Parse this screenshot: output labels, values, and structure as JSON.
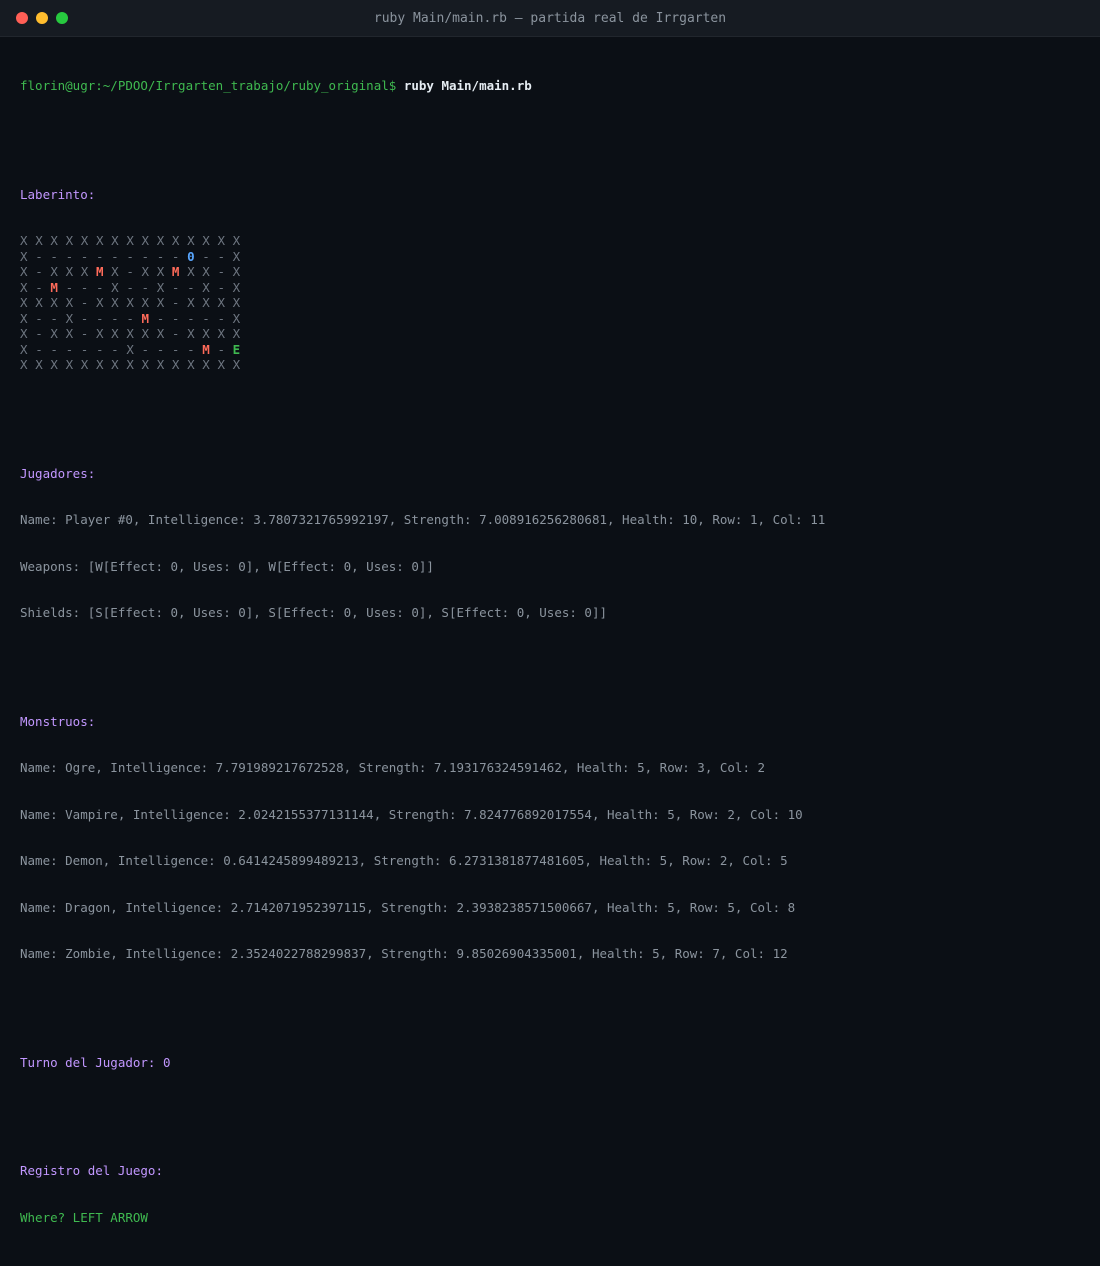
{
  "window": {
    "title": "ruby Main/main.rb — partida real de Irrgarten"
  },
  "prompt": {
    "user_path": "florin@ugr:~/PDOO/Irrgarten_trabajo/ruby_original$",
    "command": "ruby Main/main.rb"
  },
  "labyrinth": {
    "heading": "Laberinto:",
    "rows": [
      [
        "X",
        "X",
        "X",
        "X",
        "X",
        "X",
        "X",
        "X",
        "X",
        "X",
        "X",
        "X",
        "X",
        "X",
        "X"
      ],
      [
        "X",
        "-",
        "-",
        "-",
        "-",
        "-",
        "-",
        "-",
        "-",
        "-",
        "-",
        "0",
        "-",
        "-",
        "X"
      ],
      [
        "X",
        "-",
        "X",
        "X",
        "X",
        "M",
        "X",
        "-",
        "X",
        "X",
        "M",
        "X",
        "X",
        "-",
        "X"
      ],
      [
        "X",
        "-",
        "M",
        "-",
        "-",
        "-",
        "X",
        "-",
        "-",
        "X",
        "-",
        "-",
        "X",
        "-",
        "X"
      ],
      [
        "X",
        "X",
        "X",
        "X",
        "-",
        "X",
        "X",
        "X",
        "X",
        "X",
        "-",
        "X",
        "X",
        "X",
        "X"
      ],
      [
        "X",
        "-",
        "-",
        "X",
        "-",
        "-",
        "-",
        "-",
        "M",
        "-",
        "-",
        "-",
        "-",
        "-",
        "X"
      ],
      [
        "X",
        "-",
        "X",
        "X",
        "-",
        "X",
        "X",
        "X",
        "X",
        "X",
        "-",
        "X",
        "X",
        "X",
        "X"
      ],
      [
        "X",
        "-",
        "-",
        "-",
        "-",
        "-",
        "-",
        "X",
        "-",
        "-",
        "-",
        "-",
        "M",
        "-",
        "E"
      ],
      [
        "X",
        "X",
        "X",
        "X",
        "X",
        "X",
        "X",
        "X",
        "X",
        "X",
        "X",
        "X",
        "X",
        "X",
        "X"
      ]
    ]
  },
  "players": {
    "heading": "Jugadores:",
    "lines": [
      "Name: Player #0, Intelligence: 3.7807321765992197, Strength: 7.008916256280681, Health: 10, Row: 1, Col: 11",
      "Weapons: [W[Effect: 0, Uses: 0], W[Effect: 0, Uses: 0]]",
      "Shields: [S[Effect: 0, Uses: 0], S[Effect: 0, Uses: 0], S[Effect: 0, Uses: 0]]"
    ]
  },
  "monsters": {
    "heading": "Monstruos:",
    "lines": [
      "Name: Ogre, Intelligence: 7.791989217672528, Strength: 7.193176324591462, Health: 5, Row: 3, Col: 2",
      "Name: Vampire, Intelligence: 2.0242155377131144, Strength: 7.824776892017554, Health: 5, Row: 2, Col: 10",
      "Name: Demon, Intelligence: 0.6414245899489213, Strength: 6.2731381877481605, Health: 5, Row: 2, Col: 5",
      "Name: Dragon, Intelligence: 2.7142071952397115, Strength: 2.3938238571500667, Health: 5, Row: 5, Col: 8",
      "Name: Zombie, Intelligence: 2.3524022788299837, Strength: 9.85026904335001, Health: 5, Row: 7, Col: 12"
    ]
  },
  "turn": {
    "text": "Turno del Jugador: 0"
  },
  "log": {
    "heading": "Registro del Juego:",
    "lines": [
      "Where? LEFT ARROW"
    ]
  },
  "colors": {
    "background": "#0b0f15",
    "titlebar": "#161b22",
    "heading": "#c297ff",
    "prompt_user": "#3fb950",
    "monster": "#ff6b5a",
    "player": "#58a6ff",
    "exit": "#3fb950",
    "wall": "#6e7681"
  }
}
